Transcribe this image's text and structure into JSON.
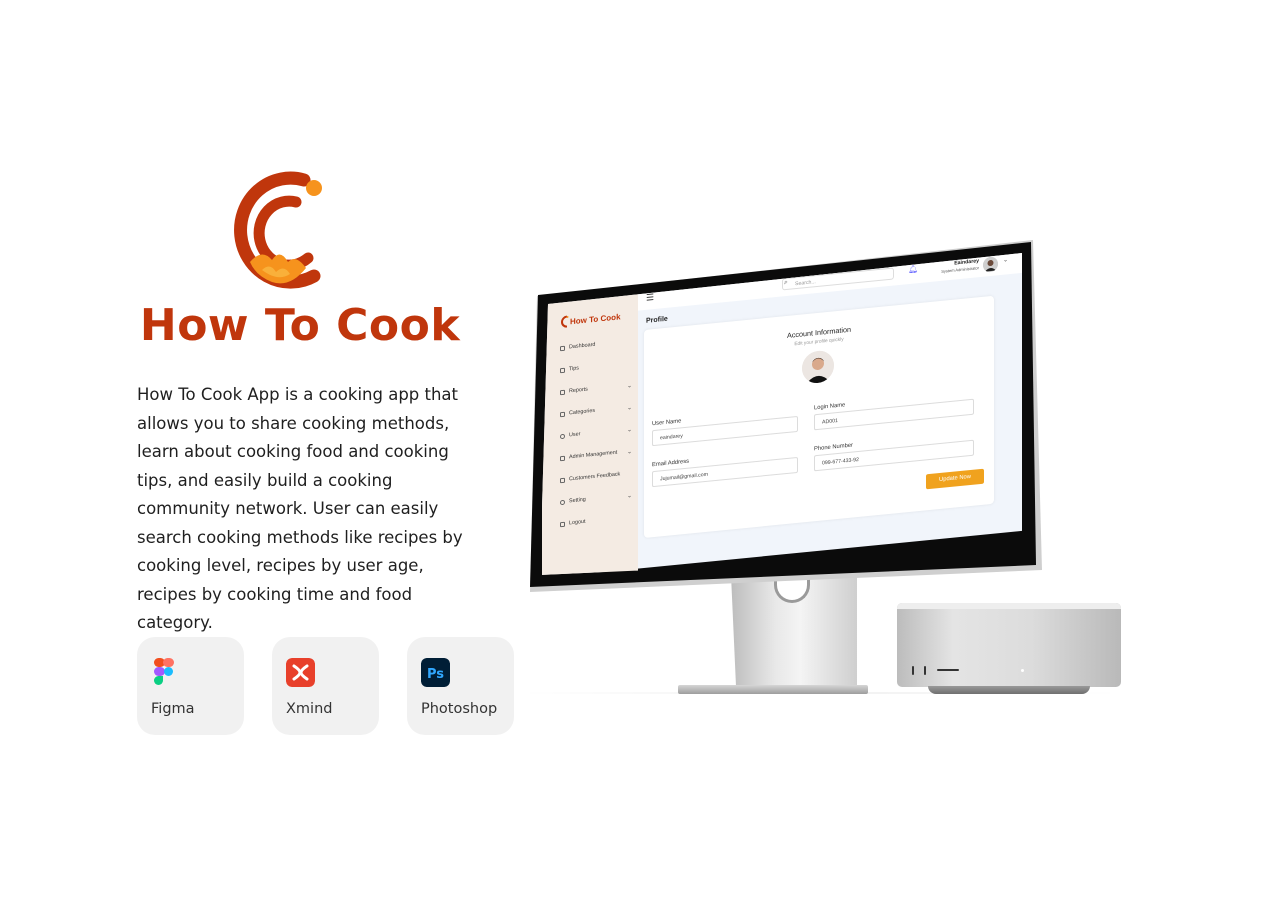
{
  "brand": {
    "title": "How To Cook",
    "description": "How To Cook App is a cooking app that allows you to share cooking methods, learn about cooking food and cooking tips, and easily build a cooking community network. User can easily search cooking methods like recipes by cooking level, recipes by user age, recipes by cooking time and food category.",
    "colors": {
      "primary": "#c0360c",
      "accent": "#f6931d"
    }
  },
  "tools": [
    {
      "label": "Figma",
      "icon": "figma-icon"
    },
    {
      "label": "Xmind",
      "icon": "xmind-icon"
    },
    {
      "label": "Photoshop",
      "icon": "photoshop-icon",
      "icon_text": "Ps"
    }
  ],
  "app": {
    "brand": "How To Cook",
    "sidebar": [
      {
        "label": "Dashboard",
        "icon": "dashboard-icon",
        "has_submenu": false
      },
      {
        "label": "Tips",
        "icon": "tips-icon",
        "has_submenu": false
      },
      {
        "label": "Reports",
        "icon": "reports-icon",
        "has_submenu": true
      },
      {
        "label": "Categories",
        "icon": "categories-icon",
        "has_submenu": true
      },
      {
        "label": "User",
        "icon": "user-icon",
        "has_submenu": true
      },
      {
        "label": "Admin Management",
        "icon": "admin-icon",
        "has_submenu": true
      },
      {
        "label": "Customers Feedback",
        "icon": "feedback-icon",
        "has_submenu": false
      },
      {
        "label": "Setting",
        "icon": "setting-icon",
        "has_submenu": true
      },
      {
        "label": "Logout",
        "icon": "logout-icon",
        "has_submenu": false
      }
    ],
    "topbar": {
      "search_placeholder": "Search...",
      "user_name": "Eaindarey",
      "user_role": "System Administrator"
    },
    "page_title": "Profile",
    "account": {
      "title": "Account Information",
      "subtitle": "Edit your profile quickly",
      "fields": {
        "user_name": {
          "label": "User Name",
          "value": "eaindarey"
        },
        "login_name": {
          "label": "Login Name",
          "value": "AD001"
        },
        "email": {
          "label": "Email Address",
          "value": "Jujumail@gmail.com"
        },
        "phone": {
          "label": "Phone Number",
          "value": "099-677-433-92"
        }
      },
      "update_label": "Update Now",
      "update_color": "#f0a21e"
    }
  }
}
